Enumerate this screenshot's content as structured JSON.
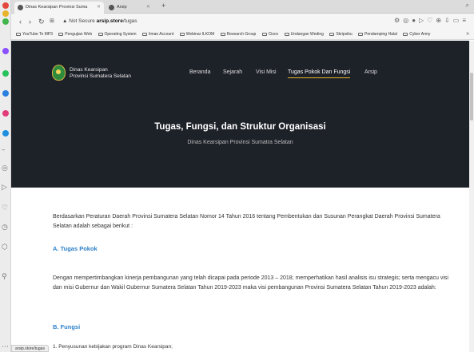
{
  "browser": {
    "tabs": [
      {
        "label": "Dinas Kearsipan Provinsi Suma",
        "active": true
      },
      {
        "label": "Arsip",
        "active": false
      }
    ],
    "new_tab": "+",
    "url_prefix": "Not Secure",
    "url_domain": "arsip.store",
    "url_path": "/tugas",
    "bookmarks": [
      "YouTube To MP3",
      "Pengujian Web",
      "Operating System",
      "Iiman Account",
      "Webinar ILKOM",
      "Research Group",
      "Cisco",
      "Undangan Weding",
      "Skripsiku",
      "Pendamping Halal",
      "Cyber Army"
    ],
    "status_url": "arsip.store/tugas"
  },
  "site": {
    "brand_line1": "Dinas Kearsipan",
    "brand_line2": "Provinsi Sumatera Selatan",
    "nav": [
      "Beranda",
      "Sejarah",
      "Visi Misi",
      "Tugas Pokok Dan Fungsi",
      "Arsip"
    ],
    "nav_active": "Tugas Pokok Dan Fungsi",
    "hero_title": "Tugas, Fungsi, dan Struktur Organisasi",
    "hero_subtitle": "Dinas Kearsipan Provinsi Sumatra Selatan"
  },
  "content": {
    "intro": "Berdasarkan Peraturan Daerah Provinsi Sumatera Selatan Nomor 14 Tahun 2016 tentang Pembentukan dan Susunan Perangkat Daerah Provinsi Sumatera Selatan adalah sebagai berikut :",
    "heading_a": "A. Tugas Pokok",
    "para_a": "Dengan mempertimbangkan kinerja pembangunan yang telah dicapai pada periode 2013 – 2018; memperhatikan hasil analisis isu strategis; serta mengacu visi dan misi Gubernur dan Wakil Gubernur Sumatera Selatan Tahun 2019-2023 maka visi pembangunan Provinsi Sumatera Selatan Tahun 2019-2023 adalah:",
    "heading_b": "B. Fungsi",
    "list_item_1": "1. Penyusunan kebijakan program Dinas Kearsipan;"
  },
  "colors": {
    "hero_bg": "#1d2128",
    "accent_underline": "#e8b52a",
    "heading_blue": "#2c7fc9"
  }
}
